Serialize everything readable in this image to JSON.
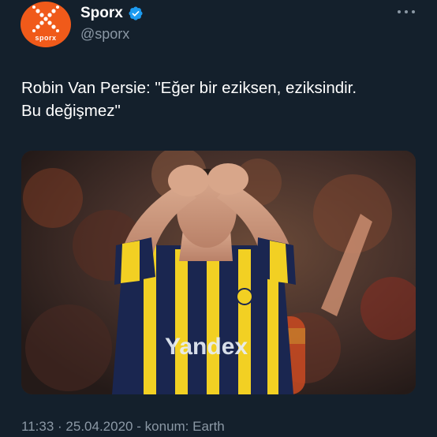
{
  "account": {
    "display_name": "Sporx",
    "handle": "@sporx",
    "avatar_text": "sporx",
    "verified": true
  },
  "tweet": {
    "text_line1": "Robin Van Persie: \"Eğer bir eziksen, eziksindir.",
    "text_line2": "Bu değişmez\"",
    "media": {
      "jersey_text": "Yandex",
      "description_icon": "photo"
    },
    "meta": {
      "time": "11:33",
      "date": "25.04.2020",
      "location": "konum: Earth",
      "separator": "·",
      "dash": "-"
    }
  },
  "colors": {
    "background": "#14202c",
    "brand_orange": "#f05a1a",
    "verified_blue": "#1d9bf0",
    "secondary_text": "#8b98a5"
  },
  "icons": {
    "more": "more-horizontal-icon",
    "verified": "verified-badge-icon",
    "logo": "sporx-logo-icon"
  }
}
